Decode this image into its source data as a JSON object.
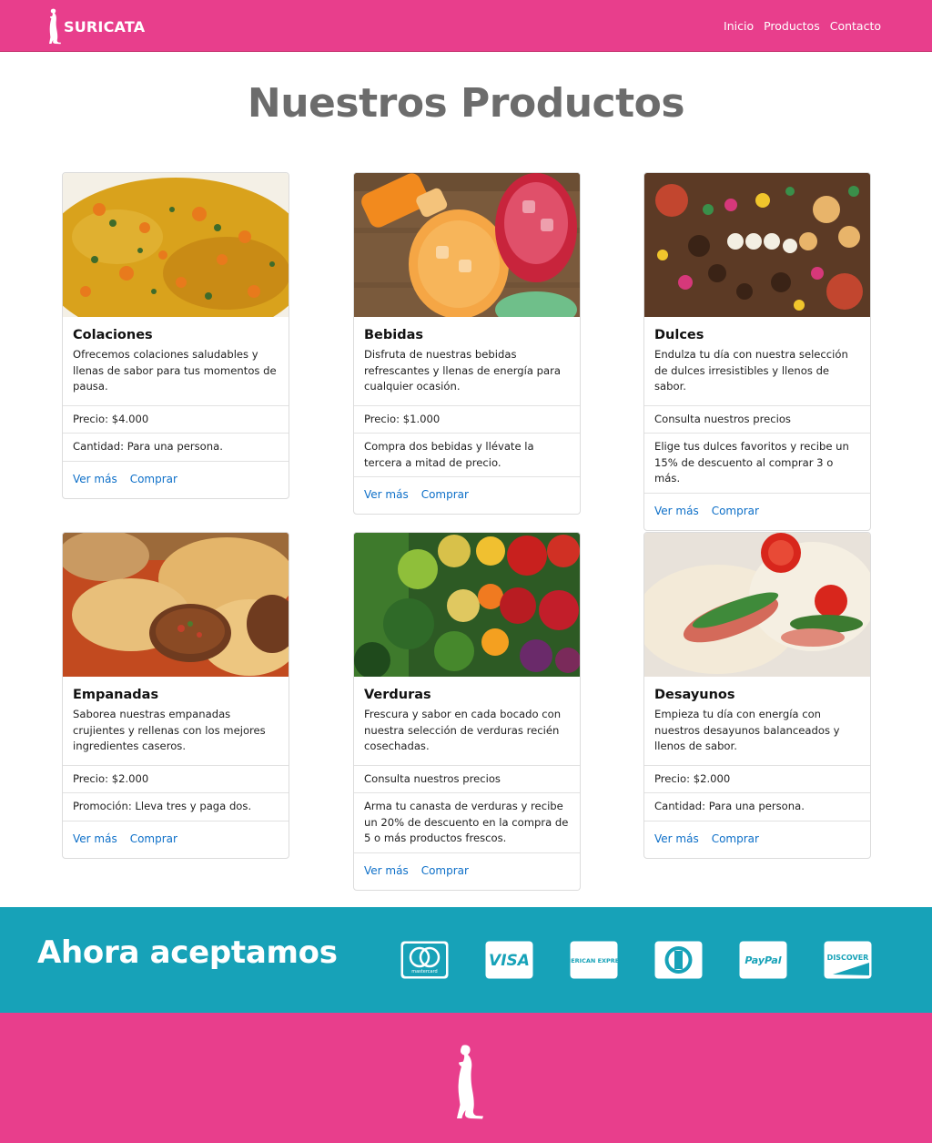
{
  "brand": {
    "name": "SURICATA"
  },
  "nav": {
    "items": [
      "Inicio",
      "Productos",
      "Contacto"
    ]
  },
  "page_title": "Nuestros Productos",
  "products": [
    {
      "title": "Colaciones",
      "description": "Ofrecemos colaciones saludables y llenas de sabor para tus momentos de pausa.",
      "details": [
        "Precio: $4.000",
        "Cantidad: Para una persona."
      ],
      "links": [
        "Ver más",
        "Comprar"
      ]
    },
    {
      "title": "Bebidas",
      "description": "Disfruta de nuestras bebidas refrescantes y llenas de energía para cualquier ocasión.",
      "details": [
        "Precio: $1.000",
        "Compra dos bebidas y llévate la tercera a mitad de precio."
      ],
      "links": [
        "Ver más",
        "Comprar"
      ]
    },
    {
      "title": "Dulces",
      "description": "Endulza tu día con nuestra selección de dulces irresistibles y llenos de sabor.",
      "details": [
        "Consulta nuestros precios",
        "Elige tus dulces favoritos y recibe un 15% de descuento al comprar 3 o más."
      ],
      "links": [
        "Ver más",
        "Comprar"
      ]
    },
    {
      "title": "Empanadas",
      "description": "Saborea nuestras empanadas crujientes y rellenas con los mejores ingredientes caseros.",
      "details": [
        "Precio: $2.000",
        "Promoción: Lleva tres y paga dos."
      ],
      "links": [
        "Ver más",
        "Comprar"
      ]
    },
    {
      "title": "Verduras",
      "description": "Frescura y sabor en cada bocado con nuestra selección de verduras recién cosechadas.",
      "details": [
        "Consulta nuestros precios",
        "Arma tu canasta de verduras y recibe un 20% de descuento en la compra de 5 o más productos frescos."
      ],
      "links": [
        "Ver más",
        "Comprar"
      ]
    },
    {
      "title": "Desayunos",
      "description": "Empieza tu día con energía con nuestros desayunos balanceados y llenos de sabor.",
      "details": [
        "Precio: $2.000",
        "Cantidad: Para una persona."
      ],
      "links": [
        "Ver más",
        "Comprar"
      ]
    }
  ],
  "payments": {
    "title": "Ahora aceptamos",
    "methods": [
      {
        "icon": "mastercard-icon",
        "label": "mastercard"
      },
      {
        "icon": "visa-icon",
        "label": "VISA"
      },
      {
        "icon": "american-express-icon",
        "label": "AMERICAN EXPRESS"
      },
      {
        "icon": "diners-club-icon",
        "label": ""
      },
      {
        "icon": "paypal-icon",
        "label": "PayPal"
      },
      {
        "icon": "discover-icon",
        "label": "DISCOVER"
      }
    ]
  },
  "colors": {
    "primary": "#e83e8c",
    "accent": "#17a2b8",
    "link": "#0d6fc8",
    "title": "#6c6c6c"
  }
}
